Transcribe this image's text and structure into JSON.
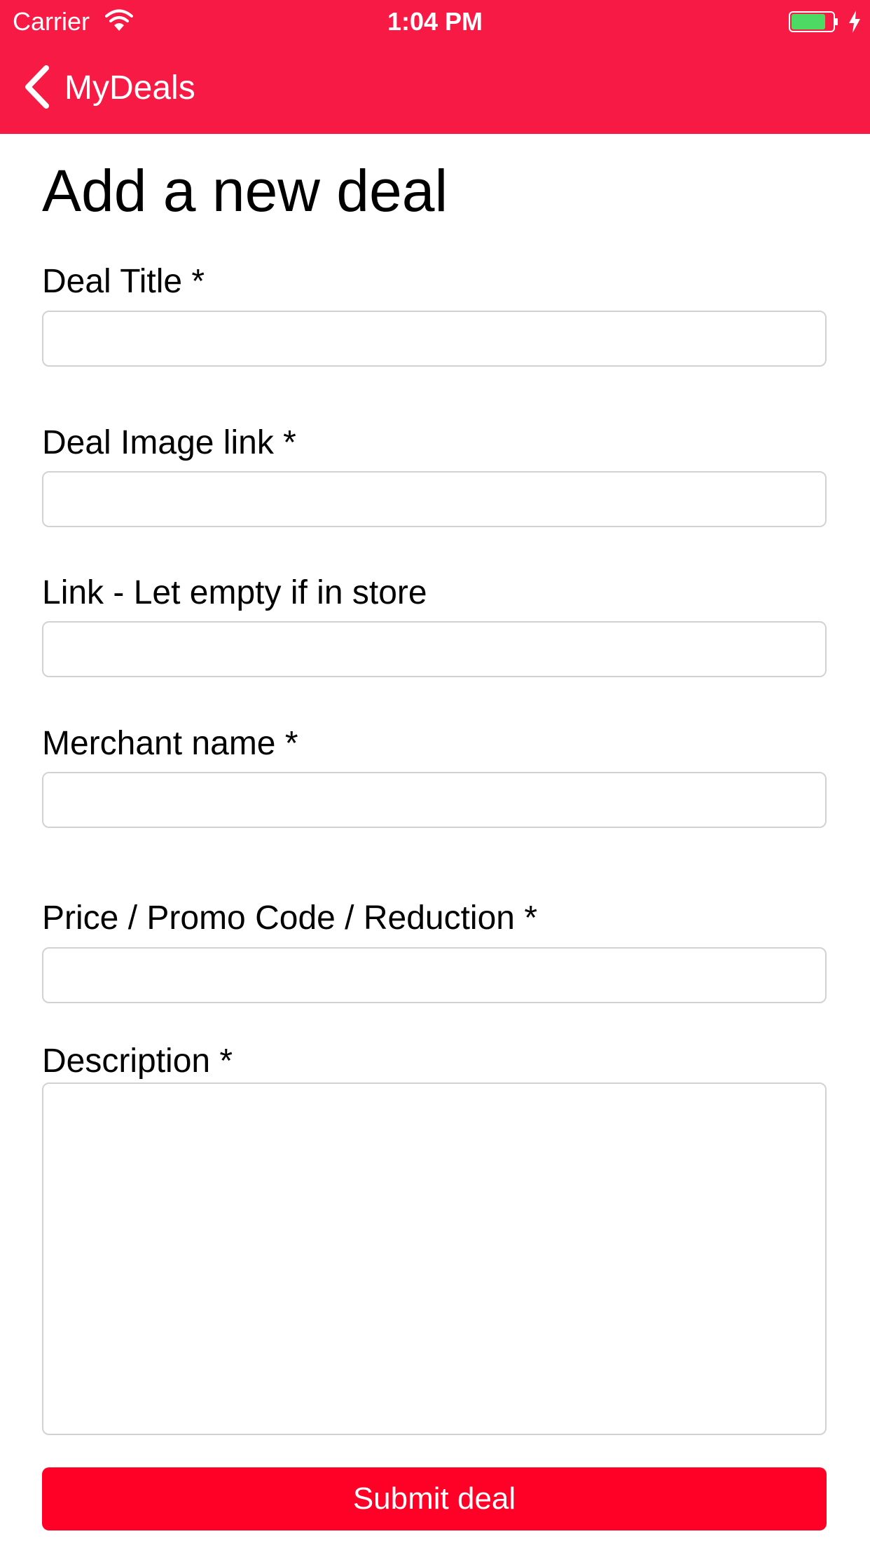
{
  "status_bar": {
    "carrier": "Carrier",
    "time": "1:04 PM",
    "wifi_icon": "wifi-icon",
    "battery_icon": "battery-icon",
    "charging_icon": "charging-bolt-icon"
  },
  "nav": {
    "back_label": "MyDeals",
    "back_icon": "chevron-left-icon"
  },
  "page": {
    "title": "Add a new deal"
  },
  "form": {
    "deal_title": {
      "label": "Deal Title *",
      "value": "",
      "placeholder": ""
    },
    "image_link": {
      "label": "Deal Image link *",
      "value": "",
      "placeholder": ""
    },
    "link": {
      "label": "Link - Let empty if in store",
      "value": "",
      "placeholder": ""
    },
    "merchant": {
      "label": "Merchant name *",
      "value": "",
      "placeholder": ""
    },
    "price": {
      "label": "Price / Promo Code / Reduction *",
      "value": "",
      "placeholder": ""
    },
    "description": {
      "label": "Description *",
      "value": "",
      "placeholder": ""
    },
    "submit_label": "Submit deal"
  },
  "colors": {
    "header_background": "#f71a45",
    "submit_background": "#ff0026",
    "input_border": "#d2d2d2",
    "battery_fill": "#4cd964"
  }
}
